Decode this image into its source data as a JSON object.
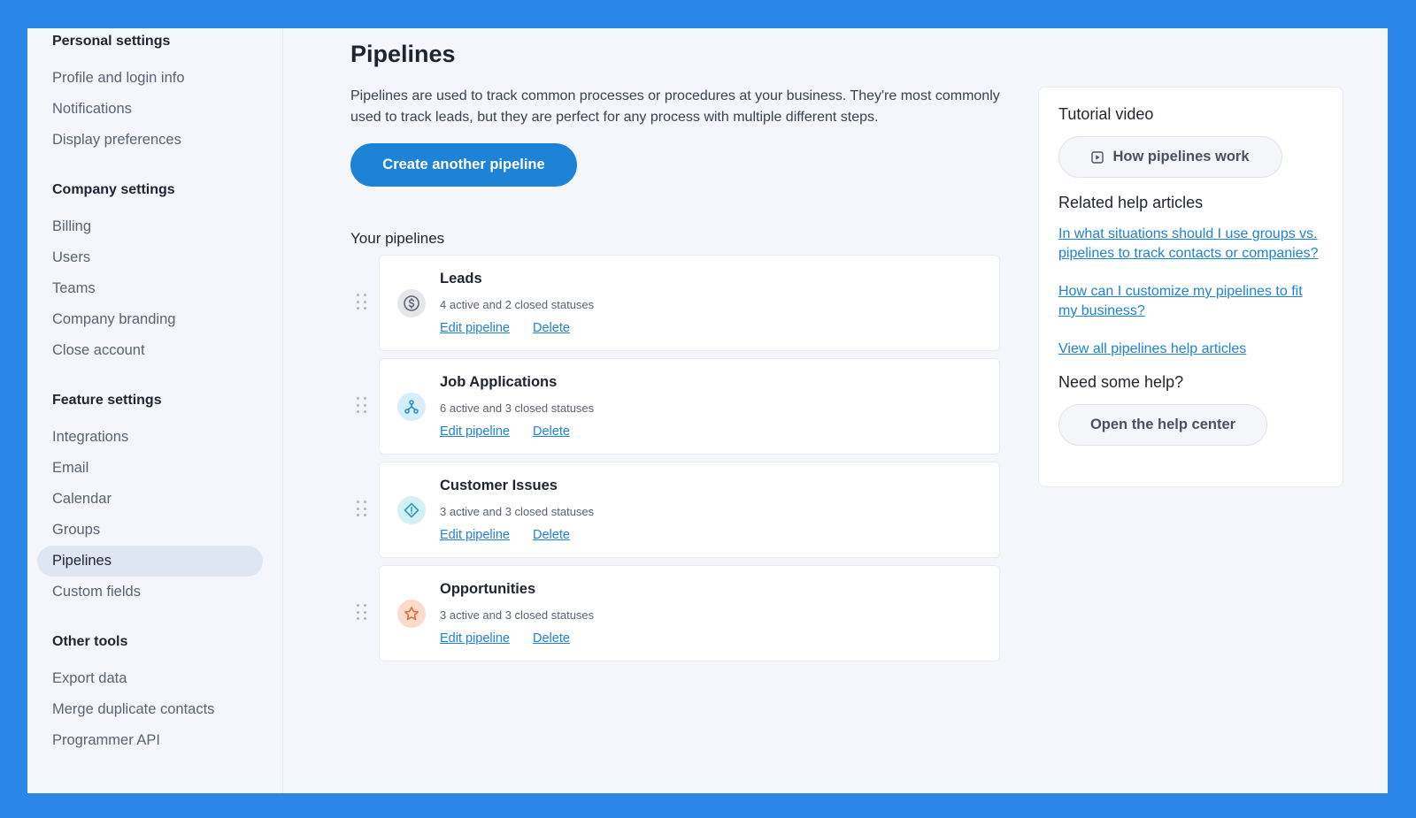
{
  "sidebar": {
    "sections": [
      {
        "heading": "Personal settings",
        "items": [
          "Profile and login info",
          "Notifications",
          "Display preferences"
        ]
      },
      {
        "heading": "Company settings",
        "items": [
          "Billing",
          "Users",
          "Teams",
          "Company branding",
          "Close account"
        ]
      },
      {
        "heading": "Feature settings",
        "items": [
          "Integrations",
          "Email",
          "Calendar",
          "Groups",
          "Pipelines",
          "Custom fields"
        ]
      },
      {
        "heading": "Other tools",
        "items": [
          "Export data",
          "Merge duplicate contacts",
          "Programmer API"
        ]
      }
    ],
    "active_item": "Pipelines"
  },
  "main": {
    "title": "Pipelines",
    "description": "Pipelines are used to track common processes or procedures at your business. They're most commonly used to track leads, but they are perfect for any process with multiple different steps.",
    "create_button": "Create another pipeline",
    "your_pipelines_label": "Your pipelines",
    "edit_label": "Edit pipeline",
    "delete_label": "Delete",
    "pipelines": [
      {
        "name": "Leads",
        "status": "4 active and 2 closed statuses",
        "icon": "dollar-icon",
        "icon_bg": "#e4e6ea",
        "icon_color": "#5f6470"
      },
      {
        "name": "Job Applications",
        "status": "6 active and 3 closed statuses",
        "icon": "hierarchy-icon",
        "icon_bg": "#d5eefa",
        "icon_color": "#2b8fc7"
      },
      {
        "name": "Customer Issues",
        "status": "3 active and 3 closed statuses",
        "icon": "diamond-icon",
        "icon_bg": "#d3f0f3",
        "icon_color": "#2aa1b0"
      },
      {
        "name": "Opportunities",
        "status": "3 active and 3 closed statuses",
        "icon": "star-icon",
        "icon_bg": "#fbdccb",
        "icon_color": "#e5693a"
      }
    ]
  },
  "help": {
    "tutorial_heading": "Tutorial video",
    "video_button": "How pipelines work",
    "related_heading": "Related help articles",
    "articles": [
      "In what situations should I use groups vs. pipelines to track contacts or companies?",
      "How can I customize my pipelines to fit my business?",
      "View all pipelines help articles"
    ],
    "need_help_heading": "Need some help?",
    "help_center_button": "Open the help center"
  },
  "colors": {
    "frame": "#2a86e8",
    "primary": "#1e82d6",
    "background": "#f4f6fb"
  }
}
